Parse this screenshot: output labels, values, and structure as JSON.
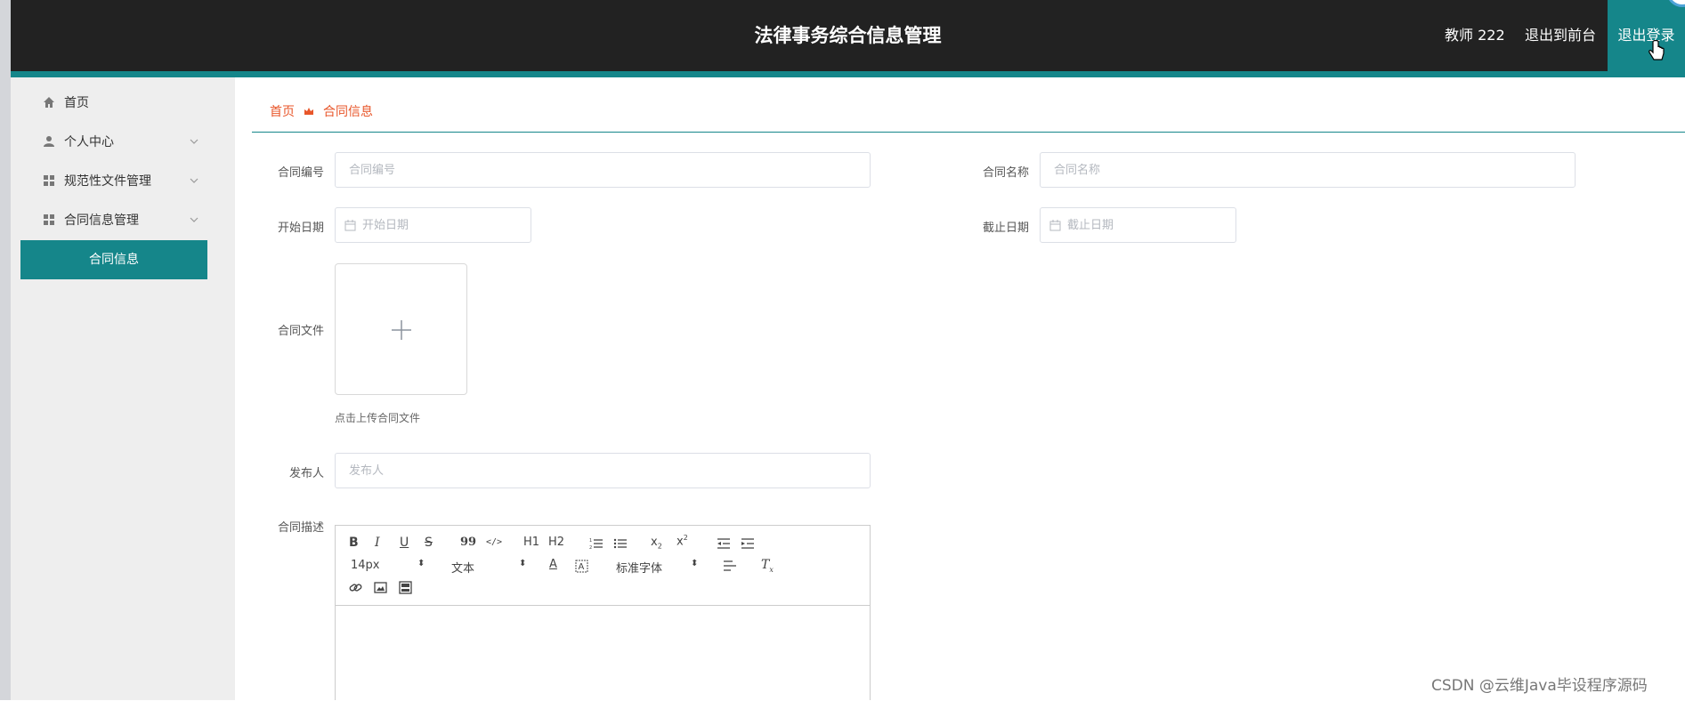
{
  "header": {
    "title": "法律事务综合信息管理",
    "user_label": "教师 222",
    "front_link": "退出到前台",
    "logout_button": "退出登录"
  },
  "sidebar": {
    "items": [
      {
        "label": "首页",
        "icon": "home-icon"
      },
      {
        "label": "个人中心",
        "icon": "user-icon"
      },
      {
        "label": "规范性文件管理",
        "icon": "grid-icon"
      },
      {
        "label": "合同信息管理",
        "icon": "grid-icon"
      }
    ],
    "active_sub_item": "合同信息"
  },
  "breadcrumb": {
    "home": "首页",
    "current": "合同信息"
  },
  "form": {
    "contract_no_label": "合同编号",
    "contract_no_placeholder": "合同编号",
    "contract_name_label": "合同名称",
    "contract_name_placeholder": "合同名称",
    "start_date_label": "开始日期",
    "start_date_placeholder": "开始日期",
    "end_date_label": "截止日期",
    "end_date_placeholder": "截止日期",
    "file_label": "合同文件",
    "file_hint": "点击上传合同文件",
    "publisher_label": "发布人",
    "publisher_placeholder": "发布人",
    "description_label": "合同描述"
  },
  "editor": {
    "toolbar_row1": [
      "B",
      "I",
      "U",
      "S",
      "99",
      "</>",
      "H1",
      "H2",
      "ol",
      "ul",
      "x2",
      "x2",
      "outdent",
      "indent"
    ],
    "font_size": "14px",
    "header_type": "文本",
    "font_family": "标准字体"
  },
  "watermark": "CSDN @云维Java毕设程序源码",
  "colors": {
    "accent": "#15868a",
    "topbar": "#222222",
    "breadcrumb": "#e8562a"
  }
}
